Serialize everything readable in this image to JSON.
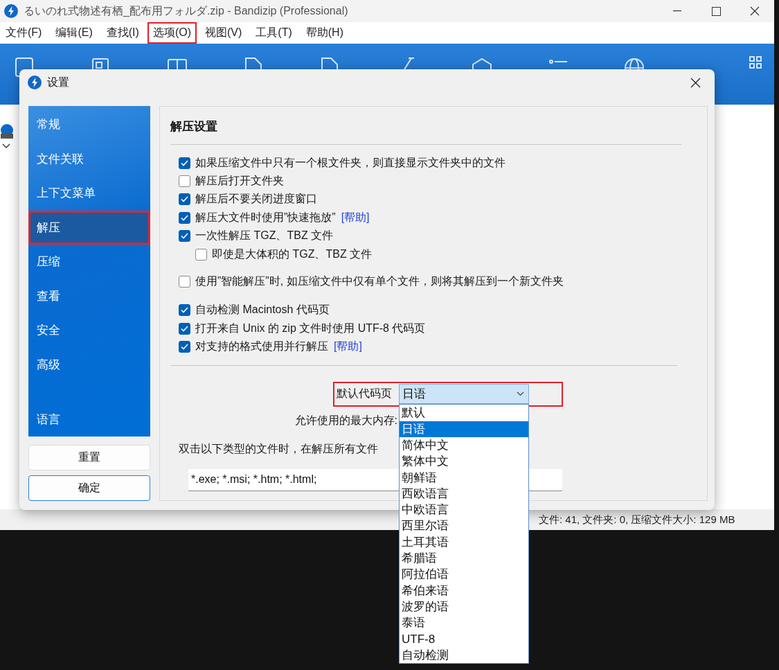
{
  "window": {
    "title": "るいのれ式物述有栖_配布用フォルダ.zip - Bandizip (Professional)"
  },
  "menu": [
    {
      "label": "文件(F)",
      "highlighted": false
    },
    {
      "label": "编辑(E)",
      "highlighted": false
    },
    {
      "label": "查找(I)",
      "highlighted": false
    },
    {
      "label": "选项(O)",
      "highlighted": true
    },
    {
      "label": "视图(V)",
      "highlighted": false
    },
    {
      "label": "工具(T)",
      "highlighted": false
    },
    {
      "label": "帮助(H)",
      "highlighted": false
    }
  ],
  "status_bar": "文件: 41, 文件夹: 0, 压缩文件大小: 129 MB",
  "dialog": {
    "title": "设置",
    "sidebar": {
      "items": [
        {
          "label": "常规",
          "selected": false,
          "highlighted": false
        },
        {
          "label": "文件关联",
          "selected": false,
          "highlighted": false
        },
        {
          "label": "上下文菜单",
          "selected": false,
          "highlighted": false
        },
        {
          "label": "解压",
          "selected": true,
          "highlighted": true
        },
        {
          "label": "压缩",
          "selected": false,
          "highlighted": false
        },
        {
          "label": "查看",
          "selected": false,
          "highlighted": false
        },
        {
          "label": "安全",
          "selected": false,
          "highlighted": false
        },
        {
          "label": "高级",
          "selected": false,
          "highlighted": false
        }
      ],
      "footer_items": [
        {
          "label": "语言",
          "selected": false,
          "highlighted": false
        }
      ]
    },
    "buttons": [
      {
        "label": "重置",
        "focused": false
      },
      {
        "label": "确定",
        "focused": true
      }
    ],
    "section_title": "解压设置",
    "option_groups": [
      [
        {
          "label": "如果压缩文件中只有一个根文件夹，则直接显示文件夹中的文件",
          "checked": true,
          "indented": false
        },
        {
          "label": "解压后打开文件夹",
          "checked": false,
          "indented": false
        },
        {
          "label": "解压后不要关闭进度窗口",
          "checked": true,
          "indented": false
        },
        {
          "label": "解压大文件时使用”快速拖放”",
          "checked": true,
          "indented": false,
          "link": "[帮助]"
        },
        {
          "label": "一次性解压 TGZ、TBZ 文件",
          "checked": true,
          "indented": false
        },
        {
          "label": "即使是大体积的 TGZ、TBZ 文件",
          "checked": false,
          "indented": true
        }
      ],
      [
        {
          "label": "使用”智能解压”时, 如压缩文件中仅有单个文件，则将其解压到一个新文件夹",
          "checked": false,
          "indented": false
        }
      ],
      [
        {
          "label": "自动检测 Macintosh 代码页",
          "checked": true,
          "indented": false
        },
        {
          "label": "打开来自 Unix 的 zip 文件时使用 UTF-8 代码页",
          "checked": true,
          "indented": false
        },
        {
          "label": "对支持的格式使用并行解压",
          "checked": true,
          "indented": false,
          "link": "[帮助]"
        }
      ]
    ],
    "code_page": {
      "label": "默认代码页",
      "value": "日语",
      "expanded": true,
      "highlighted": true,
      "options": [
        {
          "label": "默认",
          "selected": false
        },
        {
          "label": "日语",
          "selected": true
        },
        {
          "label": "简体中文",
          "selected": false
        },
        {
          "label": "繁体中文",
          "selected": false
        },
        {
          "label": "朝鲜语",
          "selected": false
        },
        {
          "label": "西欧语言",
          "selected": false
        },
        {
          "label": "中欧语言",
          "selected": false
        },
        {
          "label": "西里尔语",
          "selected": false
        },
        {
          "label": "土耳其语",
          "selected": false
        },
        {
          "label": "希腊语",
          "selected": false
        },
        {
          "label": "阿拉伯语",
          "selected": false
        },
        {
          "label": "希伯来语",
          "selected": false
        },
        {
          "label": "波罗的语",
          "selected": false
        },
        {
          "label": "泰语",
          "selected": false
        },
        {
          "label": "UTF-8",
          "selected": false
        },
        {
          "label": "自动检测",
          "selected": false
        }
      ]
    },
    "max_memory": {
      "label": "允许使用的最大内存:"
    },
    "extract_note": "双击以下类型的文件时，在解压所有文件",
    "file_types": {
      "value": "*.exe; *.msi; *.htm; *.html;"
    }
  }
}
